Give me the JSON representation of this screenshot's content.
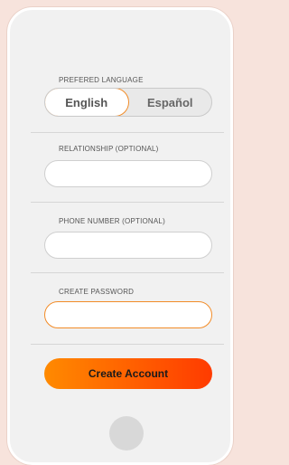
{
  "language": {
    "label": "PREFERED LANGUAGE",
    "options": [
      "English",
      "Español"
    ],
    "selected": "English"
  },
  "relationship": {
    "label": "RELATIONSHIP (OPTIONAL)",
    "value": ""
  },
  "phone": {
    "label": "PHONE NUMBER (OPTIONAL)",
    "value": ""
  },
  "password": {
    "label": "CREATE PASSWORD",
    "value": ""
  },
  "submit": {
    "label": "Create Account"
  },
  "colors": {
    "accent": "#f28c28",
    "button_start": "#ff8a00",
    "button_end": "#ff3b00"
  }
}
